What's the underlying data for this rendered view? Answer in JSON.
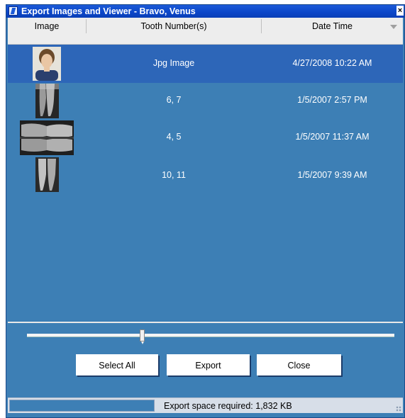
{
  "window": {
    "title": "Export Images and Viewer - Bravo, Venus",
    "close_label": "×"
  },
  "grid": {
    "columns": [
      "Image",
      "Tooth Number(s)",
      "Date Time"
    ],
    "rows": [
      {
        "image": "portrait-photo",
        "teeth": "Jpg Image",
        "datetime": "4/27/2008 10:22 AM",
        "selected": true
      },
      {
        "image": "xray-periapical",
        "teeth": "6, 7",
        "datetime": "1/5/2007 2:57 PM",
        "selected": false
      },
      {
        "image": "xray-bitewing",
        "teeth": "4, 5",
        "datetime": "1/5/2007 11:37 AM",
        "selected": false
      },
      {
        "image": "xray-periapical",
        "teeth": "10, 11",
        "datetime": "1/5/2007 9:39 AM",
        "selected": false
      }
    ]
  },
  "slider": {
    "value_fraction": 0.31
  },
  "buttons": {
    "select_all": "Select All",
    "export": "Export",
    "close": "Close"
  },
  "status": {
    "text": "Export space required: 1,832 KB"
  },
  "colors": {
    "panel": "#3d7fb5",
    "selected_row": "#2d66b8",
    "titlebar": "#0b46c8"
  }
}
